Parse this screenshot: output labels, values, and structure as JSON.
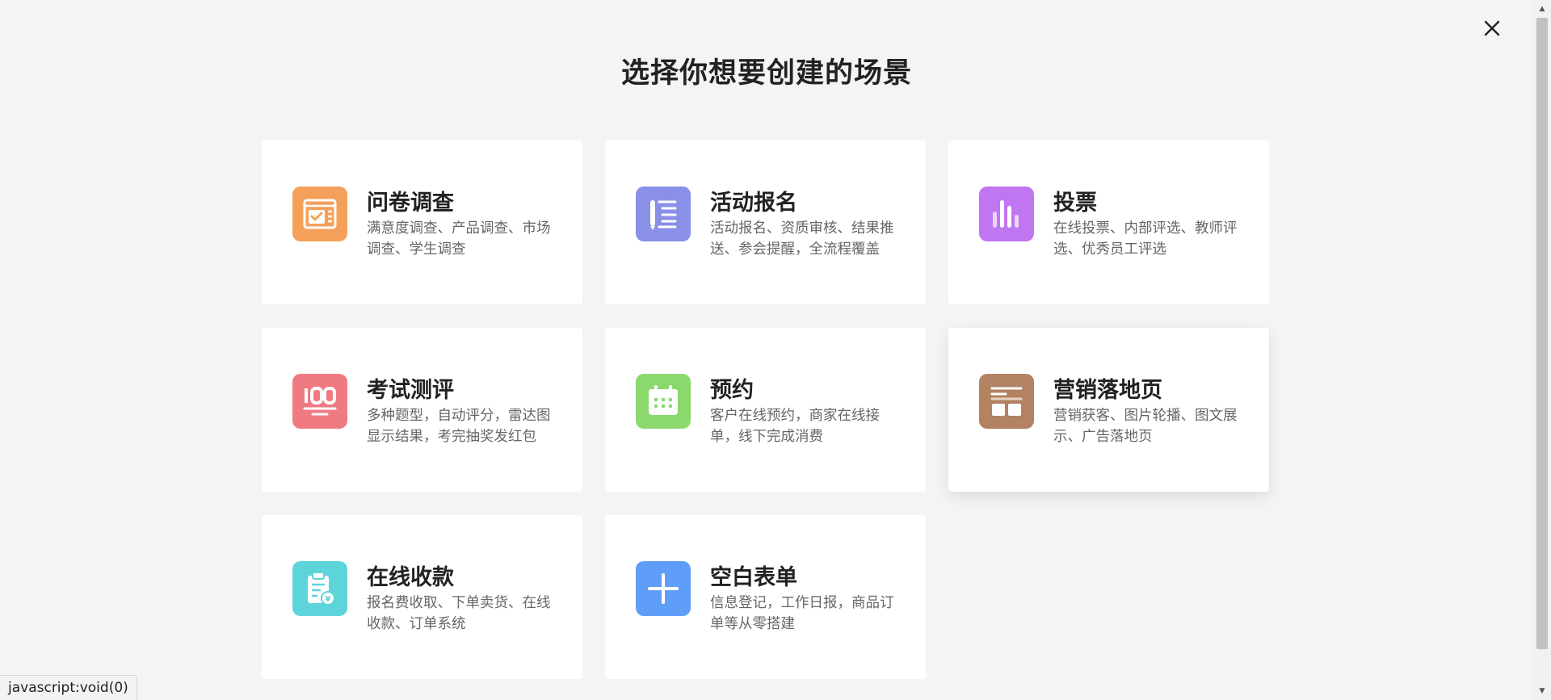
{
  "header": {
    "title": "选择你想要创建的场景"
  },
  "icons": {
    "close": "close-icon"
  },
  "cards": [
    {
      "title": "问卷调查",
      "desc": "满意度调查、产品调查、市场调查、学生调查",
      "icon": "survey-icon",
      "color": "#f5a05a"
    },
    {
      "title": "活动报名",
      "desc": "活动报名、资质审核、结果推送、参会提醒，全流程覆盖",
      "icon": "registration-icon",
      "color": "#8a8fe8"
    },
    {
      "title": "投票",
      "desc": "在线投票、内部评选、教师评选、优秀员工评选",
      "icon": "vote-icon",
      "color": "#bf76f0"
    },
    {
      "title": "考试测评",
      "desc": "多种题型，自动评分，雷达图显示结果，考完抽奖发红包",
      "icon": "exam-icon",
      "color": "#f07a82"
    },
    {
      "title": "预约",
      "desc": "客户在线预约，商家在线接单，线下完成消费",
      "icon": "calendar-icon",
      "color": "#8bd86d"
    },
    {
      "title": "营销落地页",
      "desc": "营销获客、图片轮播、图文展示、广告落地页",
      "icon": "landing-page-icon",
      "color": "#b28262"
    },
    {
      "title": "在线收款",
      "desc": "报名费收取、下单卖货、在线收款、订单系统",
      "icon": "payment-icon",
      "color": "#5dd4da"
    },
    {
      "title": "空白表单",
      "desc": "信息登记，工作日报，商品订单等从零搭建",
      "icon": "plus-icon",
      "color": "#5f9ef8"
    }
  ],
  "status_bar": {
    "text": "javascript:void(0)"
  }
}
